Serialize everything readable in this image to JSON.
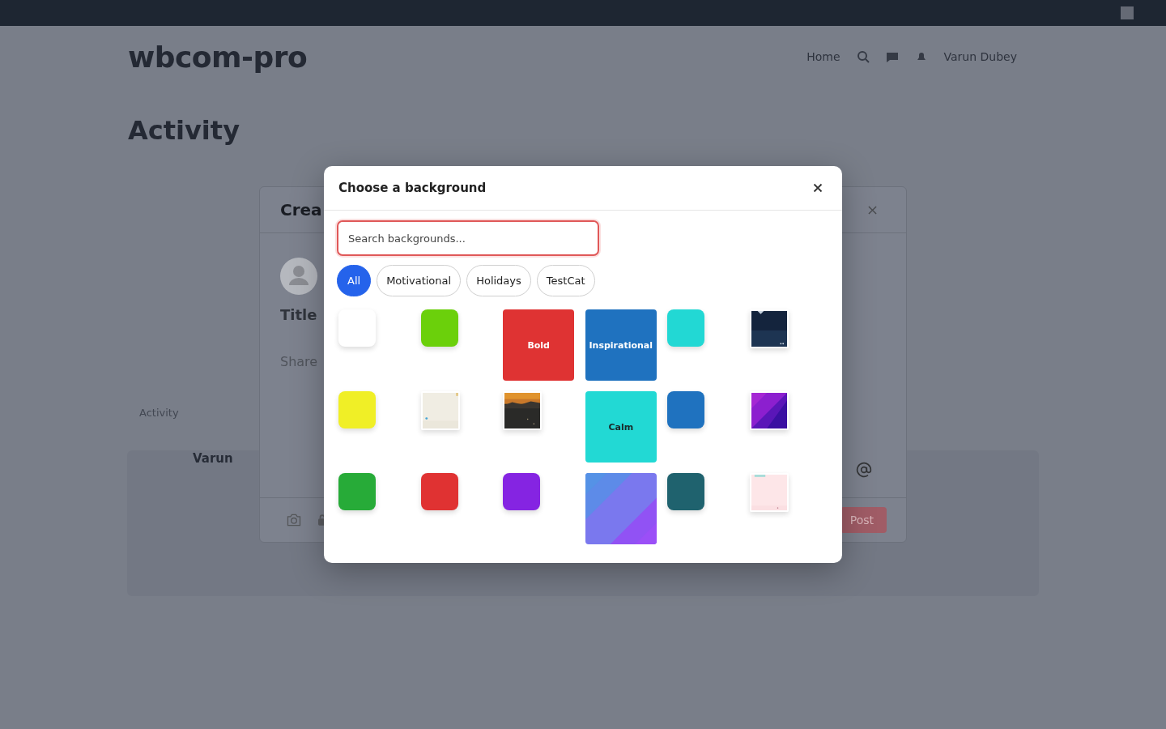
{
  "site": {
    "logo": "wbcom-pro",
    "nav": [
      "Home"
    ],
    "user_name": "Varun Dubey"
  },
  "page_title": "Activity",
  "feed": {
    "heading": "Activity",
    "author": "Varun"
  },
  "create_post": {
    "title": "Crea",
    "title_field": "Title",
    "body_field": "Share",
    "post_button": "Post"
  },
  "dialog": {
    "title": "Choose a background",
    "search": {
      "placeholder": "Search backgrounds..."
    },
    "categories": [
      {
        "label": "All",
        "selected": true
      },
      {
        "label": "Motivational",
        "selected": false
      },
      {
        "label": "Holidays",
        "selected": false
      },
      {
        "label": "TestCat",
        "selected": false
      }
    ],
    "backgrounds": [
      {
        "kind": "color",
        "color": "#ffffff",
        "large": false
      },
      {
        "kind": "color",
        "color": "#6bd00b",
        "large": false
      },
      {
        "kind": "color",
        "color": "#df3333",
        "large": true,
        "label": "Bold"
      },
      {
        "kind": "color",
        "color": "#1f72bf",
        "large": true,
        "label": "Inspirational"
      },
      {
        "kind": "color",
        "color": "#22d8d4",
        "large": false
      },
      {
        "kind": "picture",
        "large": false
      },
      {
        "kind": "color",
        "color": "#f0ef26",
        "large": false
      },
      {
        "kind": "picture",
        "large": false
      },
      {
        "kind": "picture",
        "large": false
      },
      {
        "kind": "color",
        "color": "#22d9d4",
        "large": true,
        "label": "Calm"
      },
      {
        "kind": "color",
        "color": "#1f72bf",
        "large": false
      },
      {
        "kind": "picture",
        "large": false
      },
      {
        "kind": "color",
        "color": "#27ab38",
        "large": false
      },
      {
        "kind": "color",
        "color": "#e03232",
        "large": false
      },
      {
        "kind": "color",
        "color": "#8524e2",
        "large": false
      },
      {
        "kind": "picture",
        "large": true
      },
      {
        "kind": "color",
        "color": "#1f626e",
        "large": false
      },
      {
        "kind": "picture",
        "large": false
      }
    ]
  }
}
